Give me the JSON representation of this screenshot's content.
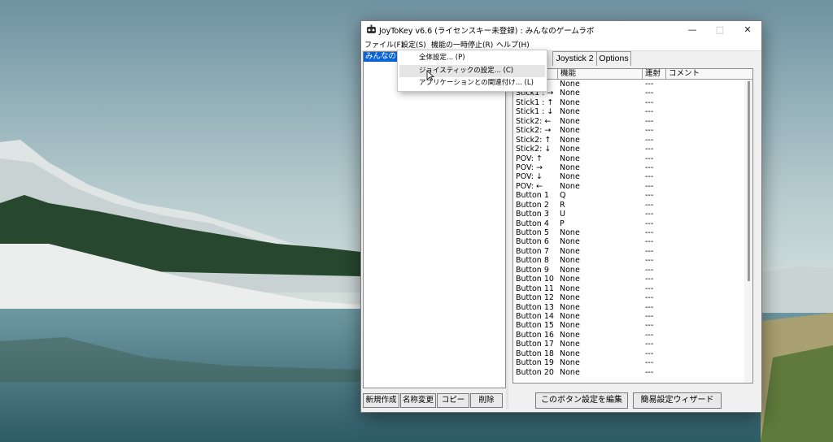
{
  "window": {
    "title": "JoyToKey v6.6 (ライセンスキー未登録) : みんなのゲームラボ",
    "minimize_symbol": "—",
    "maximize_symbol": "□",
    "close_symbol": "✕"
  },
  "menu": {
    "items": [
      "ファイル(F)",
      "設定(S)",
      "機能の一時停止(R)",
      "ヘルプ(H)"
    ]
  },
  "dropdown": {
    "items": [
      "全体設定... (P)",
      "ジョイスティックの設定... (C)",
      "アプリケーションとの関連付け... (L)"
    ]
  },
  "profiles": {
    "selected": "みんなの"
  },
  "profile_buttons": [
    "新規作成",
    "名称変更",
    "コピー",
    "削除"
  ],
  "tabs": [
    "Joystick 2",
    "Options"
  ],
  "table": {
    "headers": [
      "",
      "機能",
      "連射",
      "コメント"
    ],
    "rows": [
      [
        "",
        "None",
        "---"
      ],
      [
        "Stick1 : →",
        "None",
        "---"
      ],
      [
        "Stick1 : ↑",
        "None",
        "---"
      ],
      [
        "Stick1 : ↓",
        "None",
        "---"
      ],
      [
        "Stick2: ←",
        "None",
        "---"
      ],
      [
        "Stick2: →",
        "None",
        "---"
      ],
      [
        "Stick2: ↑",
        "None",
        "---"
      ],
      [
        "Stick2: ↓",
        "None",
        "---"
      ],
      [
        "POV: ↑",
        "None",
        "---"
      ],
      [
        "POV: →",
        "None",
        "---"
      ],
      [
        "POV: ↓",
        "None",
        "---"
      ],
      [
        "POV: ←",
        "None",
        "---"
      ],
      [
        "Button 1",
        "Q",
        "---"
      ],
      [
        "Button 2",
        "R",
        "---"
      ],
      [
        "Button 3",
        "U",
        "---"
      ],
      [
        "Button 4",
        "P",
        "---"
      ],
      [
        "Button 5",
        "None",
        "---"
      ],
      [
        "Button 6",
        "None",
        "---"
      ],
      [
        "Button 7",
        "None",
        "---"
      ],
      [
        "Button 8",
        "None",
        "---"
      ],
      [
        "Button 9",
        "None",
        "---"
      ],
      [
        "Button 10",
        "None",
        "---"
      ],
      [
        "Button 11",
        "None",
        "---"
      ],
      [
        "Button 12",
        "None",
        "---"
      ],
      [
        "Button 13",
        "None",
        "---"
      ],
      [
        "Button 14",
        "None",
        "---"
      ],
      [
        "Button 15",
        "None",
        "---"
      ],
      [
        "Button 16",
        "None",
        "---"
      ],
      [
        "Button 17",
        "None",
        "---"
      ],
      [
        "Button 18",
        "None",
        "---"
      ],
      [
        "Button 19",
        "None",
        "---"
      ],
      [
        "Button 20",
        "None",
        "---"
      ]
    ]
  },
  "bottom_buttons": {
    "edit": "このボタン設定を編集",
    "wizard": "簡易設定ウィザード"
  },
  "colors": {
    "selection": "#0a64d8",
    "dropdown_highlight": "#e5e5e5"
  }
}
